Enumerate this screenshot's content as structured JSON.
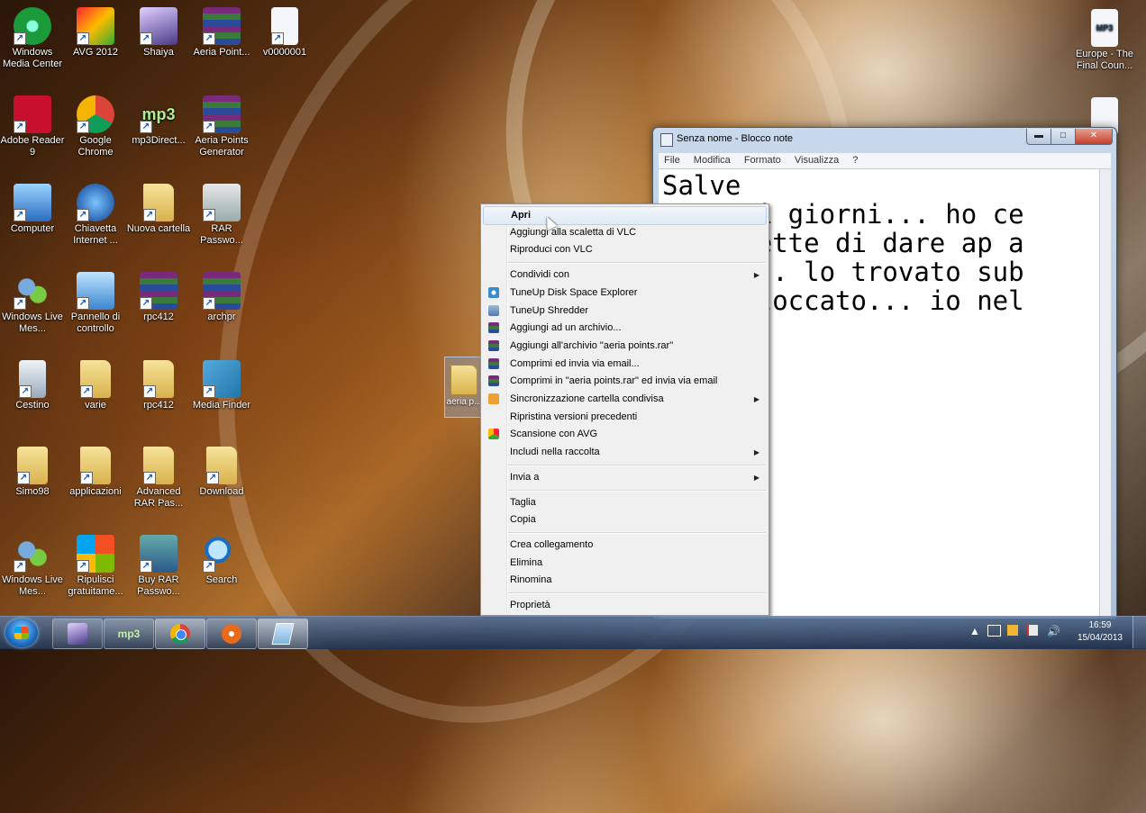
{
  "desktop": {
    "icons": [
      {
        "label": "Windows Media Center",
        "icon": "media-center-icon"
      },
      {
        "label": "AVG 2012",
        "icon": "avg-icon"
      },
      {
        "label": "Shaiya",
        "icon": "shaiya-icon"
      },
      {
        "label": "Aeria Point...",
        "icon": "winrar-icon"
      },
      {
        "label": "v0000001",
        "icon": "avi-file-icon"
      },
      {
        "label": "Adobe Reader 9",
        "icon": "adobe-reader-icon"
      },
      {
        "label": "Google Chrome",
        "icon": "chrome-icon"
      },
      {
        "label": "mp3Direct...",
        "icon": "mp3direct-icon"
      },
      {
        "label": "Aeria Points Generator",
        "icon": "winrar-icon"
      },
      {
        "label": "Computer",
        "icon": "computer-icon"
      },
      {
        "label": "Chiavetta Internet ...",
        "icon": "tim-icon"
      },
      {
        "label": "Nuova cartella",
        "icon": "folder-icon"
      },
      {
        "label": "RAR Passwo...",
        "icon": "rar-password-icon"
      },
      {
        "label": "Windows Live Mes...",
        "icon": "messenger-icon"
      },
      {
        "label": "Pannello di controllo",
        "icon": "control-panel-icon"
      },
      {
        "label": "rpc412",
        "icon": "winrar-icon"
      },
      {
        "label": "archpr",
        "icon": "winrar-icon"
      },
      {
        "label": "Cestino",
        "icon": "recycle-bin-icon"
      },
      {
        "label": "varie",
        "icon": "folder-icon"
      },
      {
        "label": "rpc412",
        "icon": "folder-icon"
      },
      {
        "label": "Media Finder",
        "icon": "media-finder-icon"
      },
      {
        "label": "Simo98",
        "icon": "user-folder-icon"
      },
      {
        "label": "applicazioni",
        "icon": "folder-icon"
      },
      {
        "label": "Advanced RAR Pas...",
        "icon": "folder-icon"
      },
      {
        "label": "Download",
        "icon": "folder-icon"
      },
      {
        "label": "Windows Live Mes...",
        "icon": "messenger-icon"
      },
      {
        "label": "Ripulisci gratuitame...",
        "icon": "windows-flag-icon"
      },
      {
        "label": "Buy RAR Passwo...",
        "icon": "rar-buy-icon"
      },
      {
        "label": "Search",
        "icon": "search-icon"
      }
    ],
    "right_icons": [
      {
        "label": "Europe - The Final Coun...",
        "icon": "mp3-file-icon",
        "badge": "MP3"
      }
    ],
    "dragged_label": "aeria p..."
  },
  "notepad": {
    "title": "Senza nome - Blocco note",
    "menu": [
      "File",
      "Modifica",
      "Formato",
      "Visualizza",
      "?"
    ],
    "text": "Salve\n    sti giorni... ho ce\n    rmette di dare ap a\n    e... lo trovato sub\n    sbloccato... io nel",
    "controls": {
      "minimize": "▬",
      "maximize": "□",
      "close": "✕"
    }
  },
  "context_menu": {
    "items": [
      {
        "label": "Apri",
        "bold": true,
        "hover": true
      },
      {
        "label": "Aggiungi alla scaletta di VLC"
      },
      {
        "label": "Riproduci con VLC"
      },
      {
        "separator": true
      },
      {
        "label": "Condividi con",
        "submenu": true
      },
      {
        "label": "TuneUp Disk Space Explorer",
        "icon": "tuneup-disk-icon"
      },
      {
        "label": "TuneUp Shredder",
        "icon": "tuneup-shredder-icon"
      },
      {
        "label": "Aggiungi ad un archivio...",
        "icon": "winrar-icon"
      },
      {
        "label": "Aggiungi all'archivio \"aeria points.rar\"",
        "icon": "winrar-icon"
      },
      {
        "label": "Comprimi ed invia via email...",
        "icon": "winrar-icon"
      },
      {
        "label": "Comprimi in \"aeria points.rar\" ed invia via email",
        "icon": "winrar-icon"
      },
      {
        "label": "Sincronizzazione cartella condivisa",
        "icon": "sync-icon",
        "submenu": true
      },
      {
        "label": "Ripristina versioni precedenti"
      },
      {
        "label": "Scansione con AVG",
        "icon": "avg-icon"
      },
      {
        "label": "Includi nella raccolta",
        "submenu": true
      },
      {
        "separator": true
      },
      {
        "label": "Invia a",
        "submenu": true
      },
      {
        "separator": true
      },
      {
        "label": "Taglia"
      },
      {
        "label": "Copia"
      },
      {
        "separator": true
      },
      {
        "label": "Crea collegamento"
      },
      {
        "label": "Elimina"
      },
      {
        "label": "Rinomina"
      },
      {
        "separator": true
      },
      {
        "label": "Proprietà"
      }
    ]
  },
  "taskbar": {
    "buttons": [
      {
        "name": "shaiya",
        "label": "",
        "icon": "shaiya-icon"
      },
      {
        "name": "mp3direct",
        "label": "mp3",
        "icon": "mp3direct-icon"
      },
      {
        "name": "chrome",
        "label": "",
        "icon": "chrome-icon"
      },
      {
        "name": "media",
        "label": "",
        "icon": "film-reel-icon"
      },
      {
        "name": "notepad",
        "label": "",
        "icon": "notepad-icon"
      }
    ],
    "clock_time": "16:59",
    "clock_date": "15/04/2013"
  },
  "colors": {
    "taskbar": "#2a4a78",
    "menu_bg": "#f0f0f0",
    "hover": "#e0eaf6"
  }
}
